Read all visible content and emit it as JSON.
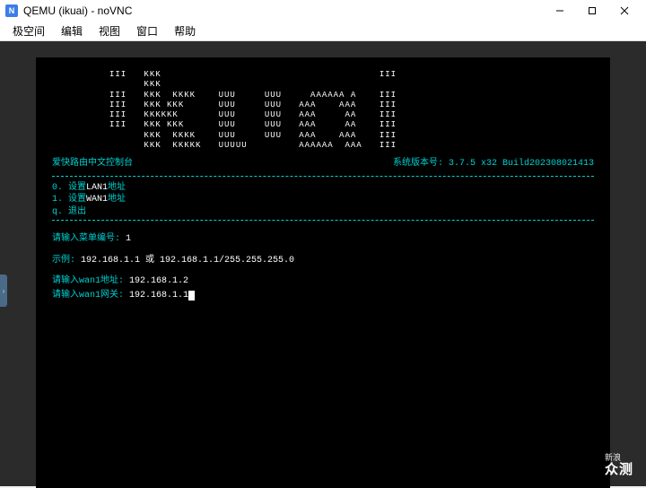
{
  "window": {
    "title": "QEMU (ikuai) - noVNC"
  },
  "menubar": {
    "items": [
      "极空间",
      "编辑",
      "视图",
      "窗口",
      "帮助"
    ]
  },
  "terminal": {
    "banner": "          III   KKK                                      III\n                KKK\n          III   KKK  KKKK    UUU     UUU     AAAAAA A    III\n          III   KKK KKK      UUU     UUU   AAA    AAA    III\n          III   KKKKKK       UUU     UUU   AAA     AA    III\n          III   KKK KKK      UUU     UUU   AAA     AA    III\n                KKK  KKKK    UUU     UUU   AAA    AAA    III\n                KKK  KKKKK   UUUUU         AAAAAA  AAA   III",
    "header_left": "爱快路由中文控制台",
    "header_right": "系统版本号: 3.7.5 x32 Build202308021413",
    "menu": [
      {
        "key": "0.",
        "text_pre": " 设置",
        "hl": "LAN1",
        "text_post": "地址"
      },
      {
        "key": "1.",
        "text_pre": " 设置",
        "hl": "WAN1",
        "text_post": "地址"
      },
      {
        "key": "q.",
        "text_pre": " 退出",
        "hl": "",
        "text_post": ""
      }
    ],
    "prompt_menu_label": "请输入菜单编号: ",
    "prompt_menu_value": "1",
    "example_label": "示例: ",
    "example_value": "192.168.1.1 或 192.168.1.1/255.255.255.0",
    "wan_addr_label": "请输入wan1地址: ",
    "wan_addr_value": "192.168.1.2",
    "wan_gw_label": "请输入wan1网关: ",
    "wan_gw_value": "192.168.1.1"
  },
  "watermark": {
    "line1": "新浪",
    "line2": "众测"
  }
}
